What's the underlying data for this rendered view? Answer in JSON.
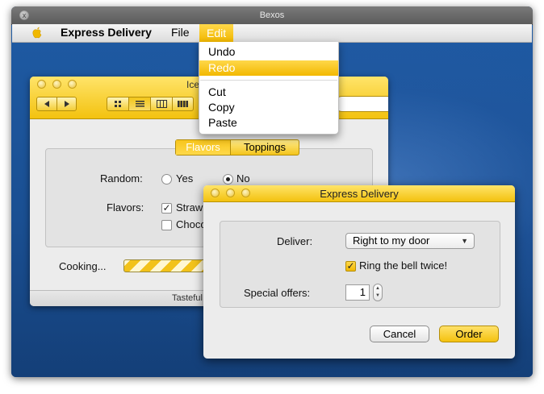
{
  "outer_window": {
    "title": "Bexos",
    "close_glyph": "x"
  },
  "menubar": {
    "apple_icon": "apple-icon",
    "app_name": "Express Delivery",
    "menus": [
      "File",
      "Edit"
    ]
  },
  "edit_menu": {
    "items": [
      "Undo",
      "Redo",
      "Cut",
      "Copy",
      "Paste"
    ],
    "selected": "Redo"
  },
  "back_window": {
    "title": "Ice",
    "tabs": [
      "Flavors",
      "Toppings"
    ],
    "active_tab": "Flavors",
    "random_label": "Random:",
    "random_options": [
      "Yes",
      "No"
    ],
    "random_selected": "No",
    "flavors_label": "Flavors:",
    "flavor_options": [
      "Straw",
      "Choco"
    ],
    "flavor_checked": [
      "Straw"
    ],
    "cooking_label": "Cooking...",
    "status_text": "Tasteful"
  },
  "delivery_dialog": {
    "title": "Express Delivery",
    "deliver_label": "Deliver:",
    "deliver_value": "Right to my door",
    "ring_bell_label": "Ring the bell twice!",
    "ring_bell_checked": true,
    "special_offers_label": "Special offers:",
    "special_offers_value": "1",
    "cancel_label": "Cancel",
    "order_label": "Order"
  },
  "colors": {
    "accent": "#f4c20f",
    "desktop": "#1a4f92"
  }
}
